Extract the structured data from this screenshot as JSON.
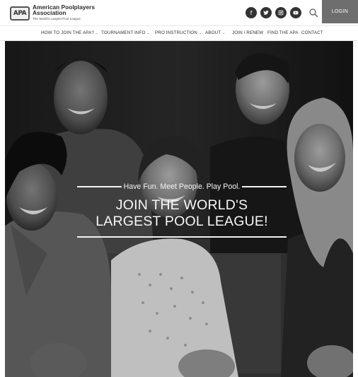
{
  "header": {
    "logo": {
      "mark": "APA",
      "name_line1": "American Poolplayers",
      "name_line2": "Association",
      "tagline": "The World's Largest Pool League"
    },
    "social": [
      {
        "name": "facebook",
        "glyph": "f"
      },
      {
        "name": "twitter",
        "glyph": ""
      },
      {
        "name": "instagram",
        "glyph": ""
      },
      {
        "name": "youtube",
        "glyph": ""
      }
    ],
    "login_label": "LOGIN"
  },
  "nav": {
    "items": [
      {
        "label": "HOW TO JOIN THE APA?",
        "has_caret": true
      },
      {
        "label": "TOURNAMENT INFO",
        "has_caret": true
      },
      {
        "label": "PRO INSTRUCTION",
        "has_caret": true
      },
      {
        "label": "ABOUT",
        "has_caret": true
      },
      {
        "label": "JOIN / RENEW",
        "has_caret": false
      },
      {
        "label": "FIND THE APA",
        "has_caret": false
      },
      {
        "label": "CONTACT",
        "has_caret": false
      }
    ],
    "caret_glyph": "⌄"
  },
  "hero": {
    "tagline": "Have Fun. Meet People. Play Pool.",
    "headline_line1": "JOIN THE WORLD'S",
    "headline_line2": "LARGEST POOL LEAGUE!"
  },
  "colors": {
    "login_bg": "#6e6e6e",
    "social_bg": "#333333",
    "hero_text": "#f7f7f7"
  }
}
